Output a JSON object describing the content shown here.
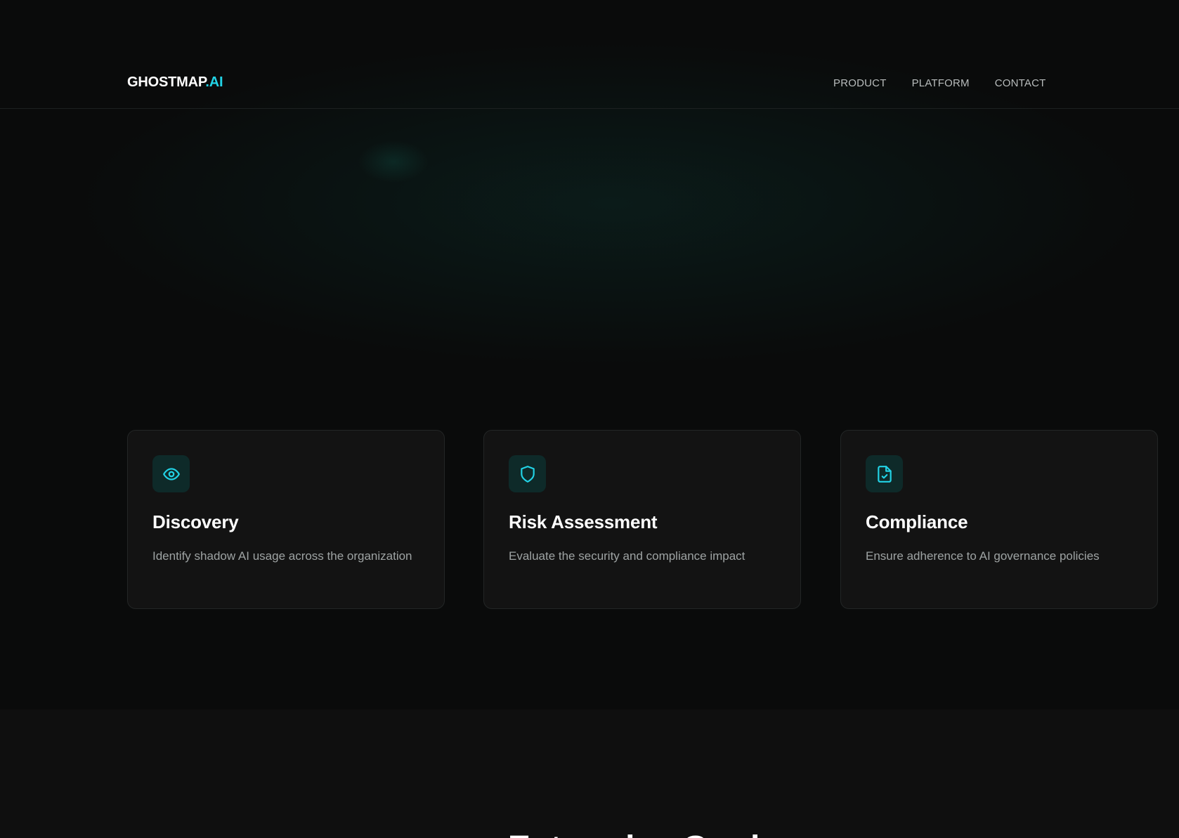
{
  "header": {
    "logo_main": "GHOSTMAP",
    "logo_accent": ".AI",
    "nav": [
      {
        "label": "PRODUCT"
      },
      {
        "label": "PLATFORM"
      },
      {
        "label": "CONTACT"
      }
    ]
  },
  "features": [
    {
      "icon": "eye-icon",
      "title": "Discovery",
      "description": "Identify shadow AI usage across the organization"
    },
    {
      "icon": "shield-icon",
      "title": "Risk Assessment",
      "description": "Evaluate the security and compliance impact"
    },
    {
      "icon": "file-check-icon",
      "title": "Compliance",
      "description": "Ensure adherence to AI governance policies"
    }
  ],
  "section2": {
    "title": "Enterprise-Grade"
  },
  "colors": {
    "accent": "#22d3e6",
    "background": "#0a0b0b",
    "card": "#131313",
    "icon_bg": "#0e2a29"
  }
}
